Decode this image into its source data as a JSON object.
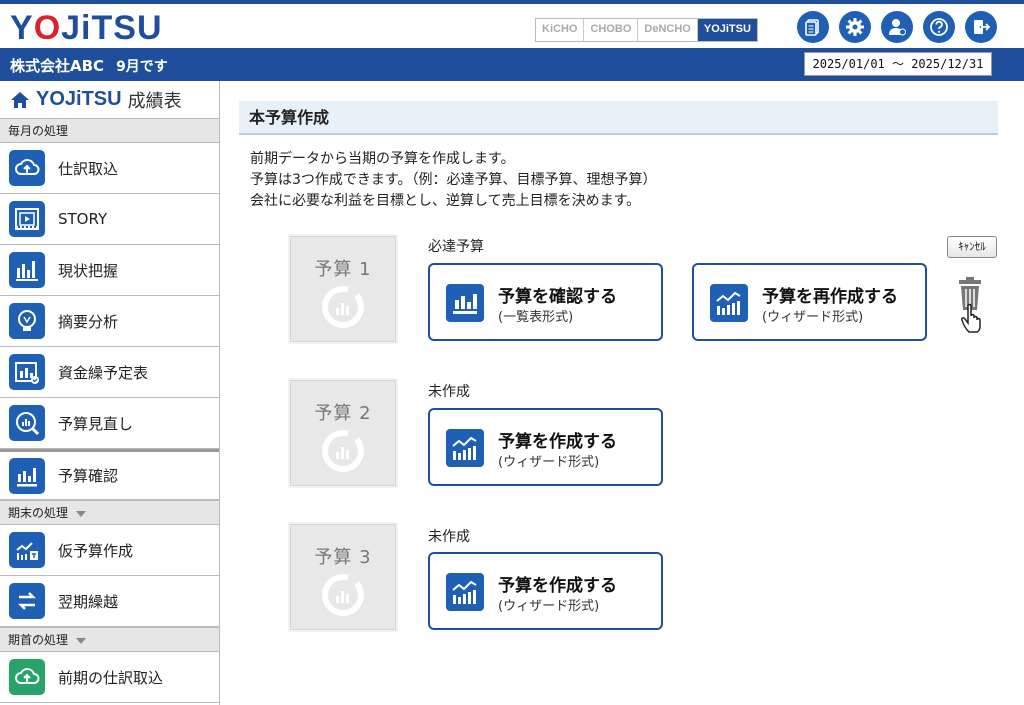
{
  "app": {
    "logo_a": "Y",
    "logo_b": "O",
    "logo_c": "JiTSU"
  },
  "product_tabs": [
    {
      "label": "KiCHO",
      "active": false
    },
    {
      "label": "CHOBO",
      "active": false
    },
    {
      "label": "DeNCHO",
      "active": false
    },
    {
      "label": "YOJiTSU",
      "active": true
    }
  ],
  "header_icons": [
    "document-icon",
    "gear-icon",
    "user-icon",
    "help-icon",
    "logout-icon"
  ],
  "company": {
    "name": "株式会社ABC",
    "month": "9月です"
  },
  "date_range": "2025/01/01 ～ 2025/12/31",
  "sidebar": {
    "title_logo": "YOJiTSU",
    "title_sub": "成績表",
    "section_monthly": "毎月の処理",
    "section_yearend": "期末の処理",
    "section_yearstart": "期首の処理",
    "items": [
      {
        "label": "仕訳取込",
        "icon": "cloud-upload-icon"
      },
      {
        "label": "STORY",
        "icon": "film-icon"
      },
      {
        "label": "現状把握",
        "icon": "bar-chart-icon"
      },
      {
        "label": "摘要分析",
        "icon": "bulb-icon"
      },
      {
        "label": "資金繰予定表",
        "icon": "calendar-chart-icon"
      },
      {
        "label": "予算見直し",
        "icon": "magnifier-chart-icon"
      },
      {
        "label": "予算確認",
        "icon": "budget-check-icon"
      },
      {
        "label": "仮予算作成",
        "icon": "temp-budget-icon"
      },
      {
        "label": "翌期繰越",
        "icon": "arrows-icon"
      },
      {
        "label": "前期の仕訳取込",
        "icon": "cloud-upload-icon"
      }
    ]
  },
  "main": {
    "title": "本予算作成",
    "desc_lines": [
      "前期データから当期の予算を作成します。",
      "予算は3つ作成できます。（例：必達予算、目標予算、理想予算）",
      "会社に必要な利益を目標とし、逆算して売上目標を決めます。"
    ],
    "cancel_label": "ｷｬﾝｾﾙ",
    "budgets": [
      {
        "label": "予算 1",
        "status": "必達予算",
        "buttons": [
          {
            "title": "予算を確認する",
            "sub": "(一覧表形式)"
          },
          {
            "title": "予算を再作成する",
            "sub": "(ウィザード形式)"
          }
        ]
      },
      {
        "label": "予算 2",
        "status": "未作成",
        "buttons": [
          {
            "title": "予算を作成する",
            "sub": "(ウィザード形式)"
          }
        ]
      },
      {
        "label": "予算 3",
        "status": "未作成",
        "buttons": [
          {
            "title": "予算を作成する",
            "sub": "(ウィザード形式)"
          }
        ]
      }
    ]
  },
  "colors": {
    "brand_blue": "#1f4f9c",
    "icon_blue": "#1f5fb4",
    "brand_red": "#d9232d",
    "green": "#27a36b"
  }
}
